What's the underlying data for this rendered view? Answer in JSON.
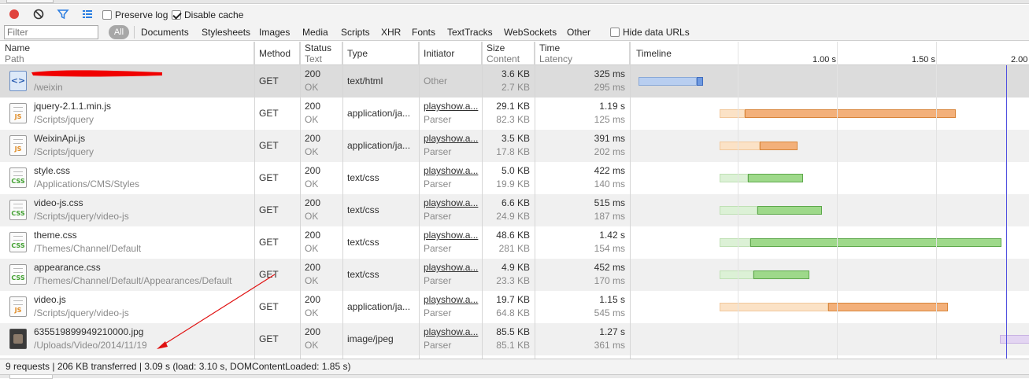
{
  "toolbar": {
    "preserve_log_label": "Preserve log",
    "preserve_log_checked": false,
    "disable_cache_label": "Disable cache",
    "disable_cache_checked": true
  },
  "filter": {
    "placeholder": "Filter",
    "all_label": "All",
    "types": [
      "Documents",
      "Stylesheets",
      "Images",
      "Media",
      "Scripts",
      "XHR",
      "Fonts",
      "TextTracks",
      "WebSockets",
      "Other"
    ],
    "hide_data_urls_label": "Hide data URLs"
  },
  "columns": {
    "name": "Name",
    "name_sub": "Path",
    "method": "Method",
    "status": "Status",
    "status_sub": "Text",
    "type": "Type",
    "initiator": "Initiator",
    "size": "Size",
    "size_sub": "Content",
    "time": "Time",
    "time_sub": "Latency",
    "timeline": "Timeline"
  },
  "timeline_ticks": [
    "1.00 s",
    "1.50 s",
    "2.00"
  ],
  "requests": [
    {
      "name": "",
      "path": "/weixin",
      "icon": "html-icon",
      "method": "GET",
      "status": "200",
      "status_text": "OK",
      "type": "text/html",
      "initiator": "Other",
      "initiator_detail": "",
      "size": "3.6 KB",
      "content": "2.7 KB",
      "time": "325 ms",
      "latency": "295 ms",
      "bar_color": "blue",
      "bar_start_s": 0.0,
      "bar_latency_s": 0.295,
      "bar_end_s": 0.325
    },
    {
      "name": "jquery-2.1.1.min.js",
      "path": "/Scripts/jquery",
      "icon": "js-icon",
      "method": "GET",
      "status": "200",
      "status_text": "OK",
      "type": "application/ja...",
      "initiator": "playshow.a...",
      "initiator_detail": "Parser",
      "size": "29.1 KB",
      "content": "82.3 KB",
      "time": "1.19 s",
      "latency": "125 ms",
      "bar_color": "orange",
      "bar_start_s": 0.41,
      "bar_latency_s": 0.535,
      "bar_end_s": 1.6
    },
    {
      "name": "WeixinApi.js",
      "path": "/Scripts/jquery",
      "icon": "js-icon",
      "method": "GET",
      "status": "200",
      "status_text": "OK",
      "type": "application/ja...",
      "initiator": "playshow.a...",
      "initiator_detail": "Parser",
      "size": "3.5 KB",
      "content": "17.8 KB",
      "time": "391 ms",
      "latency": "202 ms",
      "bar_color": "orange",
      "bar_start_s": 0.41,
      "bar_latency_s": 0.61,
      "bar_end_s": 0.8
    },
    {
      "name": "style.css",
      "path": "/Applications/CMS/Styles",
      "icon": "css-icon",
      "method": "GET",
      "status": "200",
      "status_text": "OK",
      "type": "text/css",
      "initiator": "playshow.a...",
      "initiator_detail": "Parser",
      "size": "5.0 KB",
      "content": "19.9 KB",
      "time": "422 ms",
      "latency": "140 ms",
      "bar_color": "green",
      "bar_start_s": 0.41,
      "bar_latency_s": 0.55,
      "bar_end_s": 0.83
    },
    {
      "name": "video-js.css",
      "path": "/Scripts/jquery/video-js",
      "icon": "css-icon",
      "method": "GET",
      "status": "200",
      "status_text": "OK",
      "type": "text/css",
      "initiator": "playshow.a...",
      "initiator_detail": "Parser",
      "size": "6.6 KB",
      "content": "24.9 KB",
      "time": "515 ms",
      "latency": "187 ms",
      "bar_color": "green",
      "bar_start_s": 0.41,
      "bar_latency_s": 0.6,
      "bar_end_s": 0.925
    },
    {
      "name": "theme.css",
      "path": "/Themes/Channel/Default",
      "icon": "css-icon",
      "method": "GET",
      "status": "200",
      "status_text": "OK",
      "type": "text/css",
      "initiator": "playshow.a...",
      "initiator_detail": "Parser",
      "size": "48.6 KB",
      "content": "281 KB",
      "time": "1.42 s",
      "latency": "154 ms",
      "bar_color": "green",
      "bar_start_s": 0.41,
      "bar_latency_s": 0.565,
      "bar_end_s": 1.83
    },
    {
      "name": "appearance.css",
      "path": "/Themes/Channel/Default/Appearances/Default",
      "icon": "css-icon",
      "method": "GET",
      "status": "200",
      "status_text": "OK",
      "type": "text/css",
      "initiator": "playshow.a...",
      "initiator_detail": "Parser",
      "size": "4.9 KB",
      "content": "23.3 KB",
      "time": "452 ms",
      "latency": "170 ms",
      "bar_color": "green",
      "bar_start_s": 0.41,
      "bar_latency_s": 0.58,
      "bar_end_s": 0.862
    },
    {
      "name": "video.js",
      "path": "/Scripts/jquery/video-js",
      "icon": "js-icon",
      "method": "GET",
      "status": "200",
      "status_text": "OK",
      "type": "application/ja...",
      "initiator": "playshow.a...",
      "initiator_detail": "Parser",
      "size": "19.7 KB",
      "content": "64.8 KB",
      "time": "1.15 s",
      "latency": "545 ms",
      "bar_color": "orange",
      "bar_start_s": 0.41,
      "bar_latency_s": 0.955,
      "bar_end_s": 1.56
    },
    {
      "name": "635519899949210000.jpg",
      "path": "/Uploads/Video/2014/11/19",
      "icon": "image-icon",
      "method": "GET",
      "status": "200",
      "status_text": "OK",
      "type": "image/jpeg",
      "initiator": "playshow.a...",
      "initiator_detail": "Parser",
      "size": "85.5 KB",
      "content": "85.1 KB",
      "time": "1.27 s",
      "latency": "361 ms",
      "bar_color": "purple",
      "bar_start_s": 1.82,
      "bar_latency_s": 2.18,
      "bar_end_s": 3.09
    }
  ],
  "status_bar": "9 requests | 206 KB transferred | 3.09 s (load: 3.10 s, DOMContentLoaded: 1.85 s)",
  "colors": {
    "load_line": "#4f4fe0",
    "annotation": "#e01010"
  }
}
